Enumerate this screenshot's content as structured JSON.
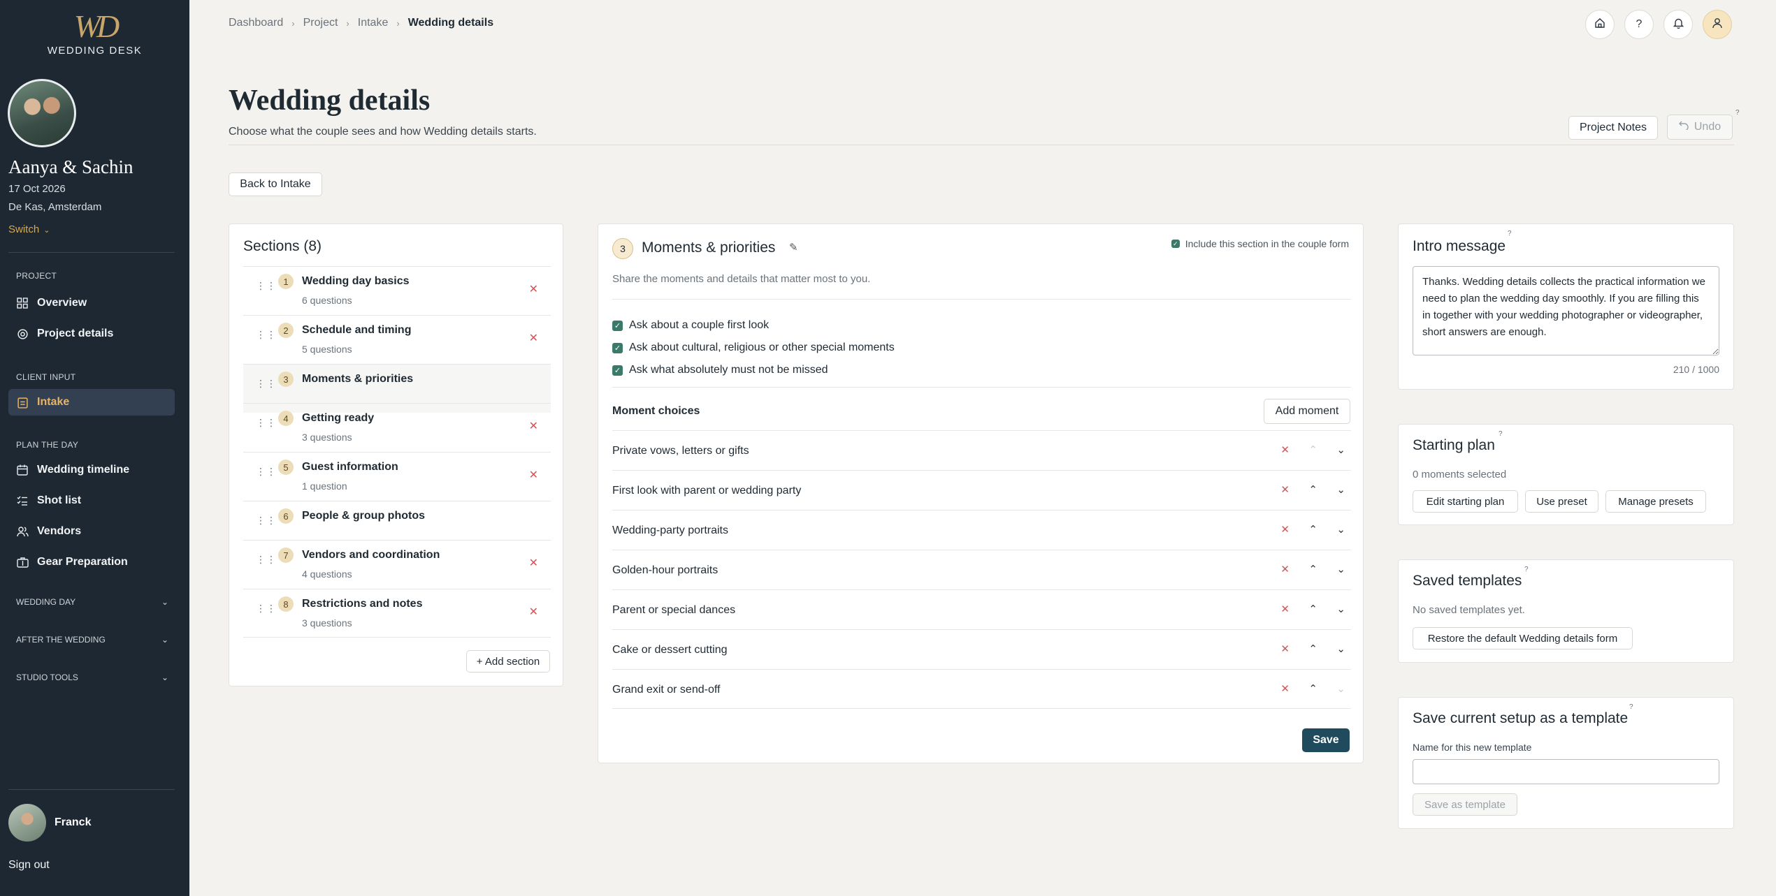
{
  "brand": {
    "logo_mark": "WD",
    "name": "WEDDING DESK"
  },
  "couple": {
    "name": "Aanya & Sachin",
    "date": "17 Oct 2026",
    "venue": "De Kas, Amsterdam",
    "switch_label": "Switch"
  },
  "nav": {
    "project_heading": "PROJECT",
    "overview": "Overview",
    "project_details": "Project details",
    "client_input_heading": "CLIENT INPUT",
    "intake": "Intake",
    "plan_heading": "PLAN THE DAY",
    "wedding_timeline": "Wedding timeline",
    "shot_list": "Shot list",
    "vendors": "Vendors",
    "gear_preparation": "Gear Preparation",
    "group_wedding_day": "WEDDING DAY",
    "group_after_wedding": "AFTER THE WEDDING",
    "group_studio_tools": "STUDIO TOOLS"
  },
  "user": {
    "name": "Franck",
    "signout": "Sign out"
  },
  "breadcrumb": {
    "items": [
      "Dashboard",
      "Project",
      "Intake"
    ],
    "current": "Wedding details"
  },
  "header": {
    "title": "Wedding details",
    "subtitle": "Choose what the couple sees and how Wedding details starts.",
    "project_notes": "Project Notes",
    "undo": "Undo",
    "back": "Back to Intake"
  },
  "sections": {
    "title": "Sections (8)",
    "items": [
      {
        "num": "1",
        "name": "Wedding day basics",
        "count": "6 questions"
      },
      {
        "num": "2",
        "name": "Schedule and timing",
        "count": "5 questions"
      },
      {
        "num": "3",
        "name": "Moments & priorities",
        "count": ""
      },
      {
        "num": "4",
        "name": "Getting ready",
        "count": "3 questions"
      },
      {
        "num": "5",
        "name": "Guest information",
        "count": "1 question"
      },
      {
        "num": "6",
        "name": "People & group photos",
        "count": ""
      },
      {
        "num": "7",
        "name": "Vendors and coordination",
        "count": "4 questions"
      },
      {
        "num": "8",
        "name": "Restrictions and notes",
        "count": "3 questions"
      }
    ],
    "add_label": "+ Add section"
  },
  "editor": {
    "num": "3",
    "title": "Moments & priorities",
    "include_label": "Include this section in the couple form",
    "description": "Share the moments and details that matter most to you.",
    "options": [
      "Ask about a couple first look",
      "Ask about cultural, religious or other special moments",
      "Ask what absolutely must not be missed"
    ],
    "choices_heading": "Moment choices",
    "add_moment": "Add moment",
    "moments": [
      "Private vows, letters or gifts",
      "First look with parent or wedding party",
      "Wedding-party portraits",
      "Golden-hour portraits",
      "Parent or special dances",
      "Cake or dessert cutting",
      "Grand exit or send-off"
    ],
    "save": "Save"
  },
  "intro": {
    "title": "Intro message",
    "text": "Thanks. Wedding details collects the practical information we need to plan the wedding day smoothly. If you are filling this in together with your wedding photographer or videographer, short answers are enough.",
    "counter": "210 / 1000"
  },
  "starting_plan": {
    "title": "Starting plan",
    "status": "0 moments selected",
    "edit": "Edit starting plan",
    "preset": "Use preset",
    "manage": "Manage presets"
  },
  "saved_templates": {
    "title": "Saved templates",
    "empty": "No saved templates yet.",
    "restore": "Restore the default Wedding details form"
  },
  "save_template": {
    "title": "Save current setup as a template",
    "field_label": "Name for this new template",
    "placeholder": "",
    "button": "Save as template"
  },
  "help_mark": "?"
}
